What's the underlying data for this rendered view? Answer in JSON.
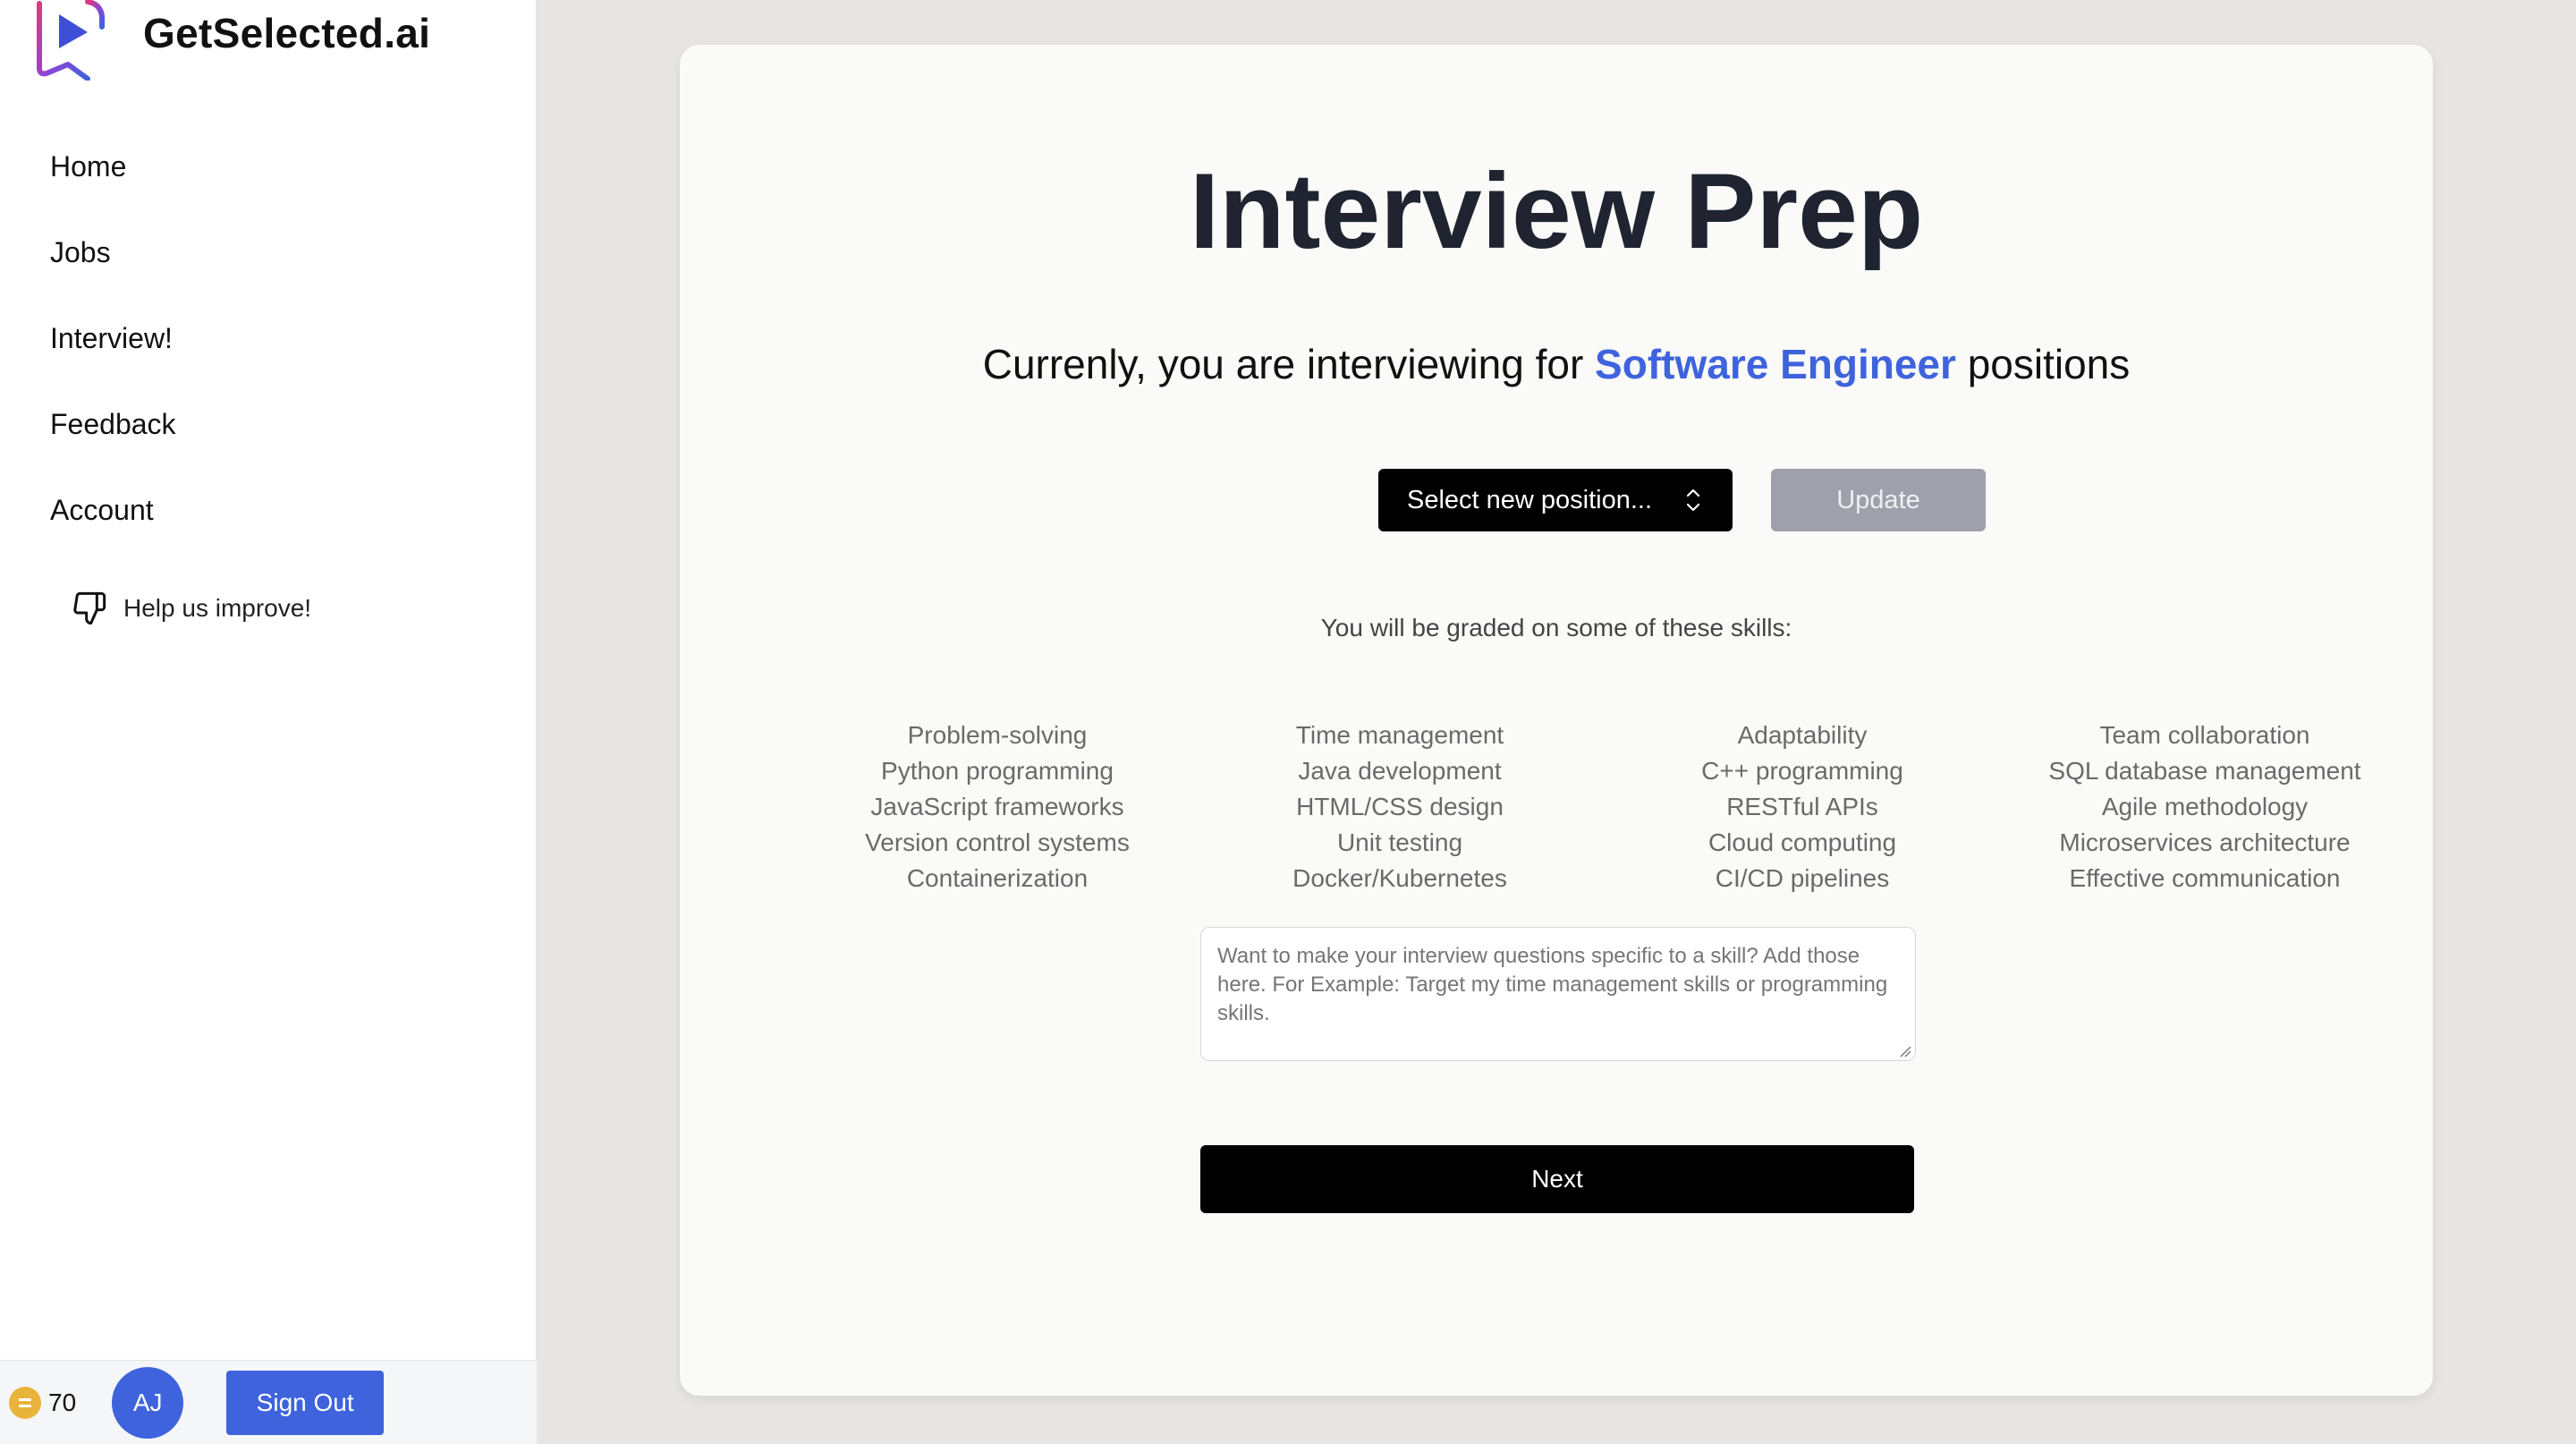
{
  "brand": {
    "name": "GetSelected.ai",
    "logo_icon": "play-cursor-logo"
  },
  "sidebar": {
    "items": [
      {
        "label": "Home"
      },
      {
        "label": "Jobs"
      },
      {
        "label": "Interview!"
      },
      {
        "label": "Feedback"
      },
      {
        "label": "Account"
      }
    ],
    "help": {
      "label": "Help us improve!",
      "icon": "thumbs-down-icon"
    },
    "footer": {
      "credits": "70",
      "avatar_initials": "AJ",
      "signout_label": "Sign Out"
    }
  },
  "main": {
    "title": "Interview Prep",
    "subtitle_prefix": "Currenly, you are interviewing for ",
    "role": "Software Engineer",
    "subtitle_suffix": " positions",
    "select_label": "Select new position...",
    "update_label": "Update",
    "graded_text": "You will be graded on some of these skills:",
    "skills": [
      [
        "Problem-solving",
        "Python programming",
        "JavaScript frameworks",
        "Version control systems",
        "Containerization"
      ],
      [
        "Time management",
        "Java development",
        "HTML/CSS design",
        "Unit testing",
        "Docker/Kubernetes"
      ],
      [
        "Adaptability",
        "C++ programming",
        "RESTful APIs",
        "Cloud computing",
        "CI/CD pipelines"
      ],
      [
        "Team collaboration",
        "SQL database management",
        "Agile methodology",
        "Microservices architecture",
        "Effective communication"
      ]
    ],
    "notes_placeholder": "Want to make your interview questions specific to a skill? Add those here. For Example: Target my time management skills or programming skills.",
    "next_label": "Next"
  },
  "colors": {
    "accent": "#3e63dd",
    "coin": "#e8b43c",
    "background": "#e7e6e4"
  }
}
